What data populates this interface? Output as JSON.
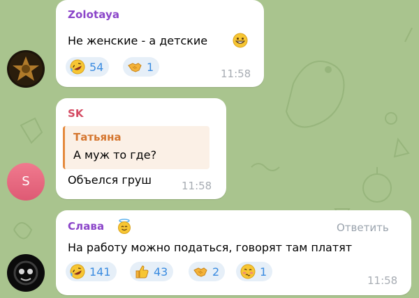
{
  "theme": {
    "background": "#a9c48e",
    "accent_reaction": "#3a8be0",
    "sender_colors": {
      "zolotaya": "#8b45c9",
      "sk": "#d44a62",
      "slava": "#8b45c9",
      "quote": "#d5762f"
    }
  },
  "messages": [
    {
      "sender": "Zolotaya",
      "avatar": "star-avatar",
      "text": "Не женские - а детские",
      "text_emoji": "grinning-face",
      "reactions": [
        {
          "emoji": "rolling-on-floor-laughing",
          "count": "54"
        },
        {
          "emoji": "handshake",
          "count": "1"
        }
      ],
      "time": "11:58"
    },
    {
      "sender": "SK",
      "avatar": "S",
      "reply": {
        "author": "Татьяна",
        "text": "А муж то где?"
      },
      "text": "Объелся груш",
      "time": "11:58"
    },
    {
      "sender": "Слава",
      "sender_emoji": "smiling-face-with-halo",
      "avatar": "dark-avatar",
      "reply_button": "Ответить",
      "text": "На работу можно податься, говорят там платят",
      "reactions": [
        {
          "emoji": "rolling-on-floor-laughing",
          "count": "141"
        },
        {
          "emoji": "thumbs-up",
          "count": "43"
        },
        {
          "emoji": "handshake",
          "count": "2"
        },
        {
          "emoji": "woozy-face",
          "count": "1"
        }
      ],
      "time": "11:58"
    }
  ]
}
